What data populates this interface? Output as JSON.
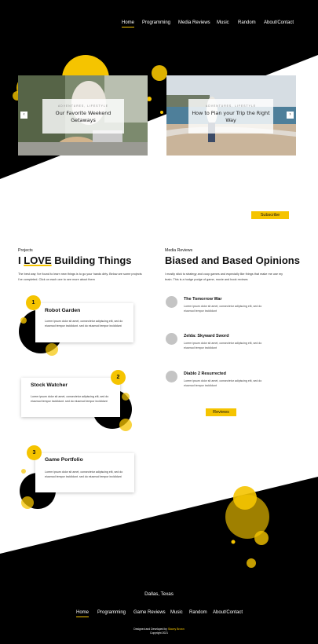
{
  "colors": {
    "accent": "#f5c400",
    "dark": "#000000",
    "light": "#ffffff"
  },
  "nav": {
    "items": [
      {
        "label": "Home",
        "active": true
      },
      {
        "label": "Programming"
      },
      {
        "label": "Media Reviews"
      },
      {
        "label": "Music"
      },
      {
        "label": "Random"
      },
      {
        "label": "About/Contact"
      }
    ]
  },
  "slider": {
    "slides": [
      {
        "category": "ADVENTURES, LIFESTYLE",
        "title": "Our Favorite Weekend Getaways"
      },
      {
        "category": "ADVENTURES, LIFESTYLE",
        "title": "How to Plan your Trip the Right Way"
      }
    ],
    "prev_icon": "chevron-left-icon",
    "next_icon": "chevron-right-icon"
  },
  "subscribe_label": "Subscribe",
  "projects": {
    "section_label": "Projects",
    "heading_prefix": "I",
    "heading_emphasis": "LOVE",
    "heading_suffix": "Building Things",
    "intro": "The best way I've found to learn new things is to go your hands dirty.  Below are some projects I've completed.  Click on each one to see more about them",
    "items": [
      {
        "number": "1",
        "title": "Robot Garden",
        "text": "Lorem ipsum dolor sit amet, consectetur adipiscing elit, sed do eiusmod tempor incididunt. sed do eiusmod tempor incididunt"
      },
      {
        "number": "2",
        "title": "Stock Watcher",
        "text": "Lorem ipsum dolor sit amet, consectetur adipiscing elit, sed do eiusmod tempor incididunt. sed do eiusmod tempor incididunt"
      },
      {
        "number": "3",
        "title": "Game Portfolio",
        "text": "Lorem ipsum dolor sit amet, consectetur adipiscing elit, sed do eiusmod tempor incididunt. sed do eiusmod tempor incididunt"
      }
    ]
  },
  "reviews": {
    "section_label": "Media Reviews",
    "heading": "Biased and Based Opinions",
    "intro": "I mostly stick to strategy and coop games and especially like things that make me use my brain.  This is a hodge podge of game, movie and book reviews",
    "items": [
      {
        "title": "The Tomorrow War",
        "text": "Lorem ipsum dolor sit amet, consectetur adipiscing elit, sed do eiusmod tempor incididunt"
      },
      {
        "title": "Zelda: Skyward Sword",
        "text": "Lorem ipsum dolor sit amet, consectetur adipiscing elit, sed do eiusmod tempor incididunt"
      },
      {
        "title": "Diablo 2 Resurrected",
        "text": "Lorem ipsum dolor sit amet, consectetur adipiscing elit, sed do eiusmod tempor incididunt"
      }
    ],
    "button_label": "Reviews"
  },
  "footer": {
    "location": "Dallas, Texas",
    "nav": [
      {
        "label": "Home",
        "active": true
      },
      {
        "label": "Programming"
      },
      {
        "label": "Game Reviews"
      },
      {
        "label": "Music"
      },
      {
        "label": "Random"
      },
      {
        "label": "About/Contact"
      }
    ],
    "credit_prefix": "Designed and Developed by",
    "credit_name": "Stacey Brown",
    "copyright": "Copyright 2021"
  }
}
